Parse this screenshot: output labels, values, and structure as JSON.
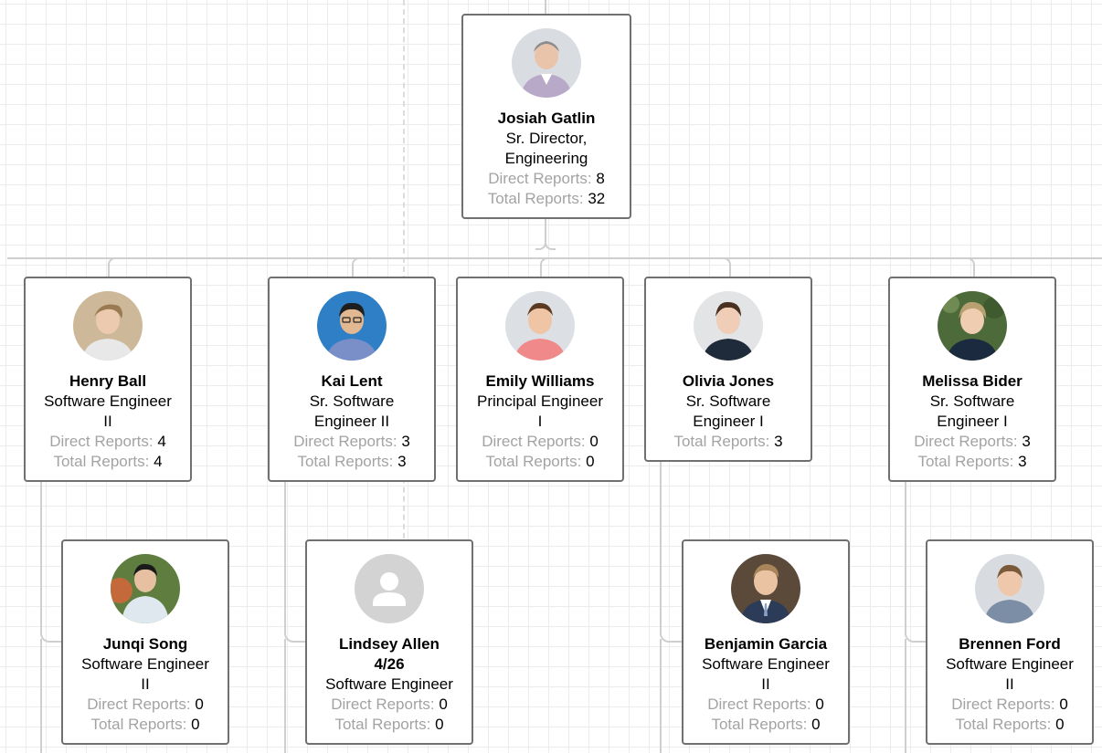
{
  "people": {
    "josiah": {
      "name": "Josiah Gatlin",
      "title_line1": "Sr. Director,",
      "title_line2": "Engineering",
      "direct_label": "Direct Reports:",
      "direct": "8",
      "total_label": "Total Reports:",
      "total": "32",
      "avatar": "photo-avatar"
    },
    "henry": {
      "name": "Henry Ball",
      "title_line1": "Software Engineer",
      "title_line2": "II",
      "direct_label": "Direct Reports:",
      "direct": "4",
      "total_label": "Total Reports:",
      "total": "4",
      "avatar": "photo-avatar"
    },
    "kai": {
      "name": "Kai Lent",
      "title_line1": "Sr. Software",
      "title_line2": "Engineer II",
      "direct_label": "Direct Reports:",
      "direct": "3",
      "total_label": "Total Reports:",
      "total": "3",
      "avatar": "photo-avatar"
    },
    "emily": {
      "name": "Emily Williams",
      "title_line1": "Principal Engineer",
      "title_line2": "I",
      "direct_label": "Direct Reports:",
      "direct": "0",
      "total_label": "Total Reports:",
      "total": "0",
      "avatar": "photo-avatar"
    },
    "olivia": {
      "name": "Olivia Jones",
      "title_line1": "Sr. Software",
      "title_line2": "Engineer I",
      "total_label": "Total Reports:",
      "total": "3",
      "avatar": "photo-avatar"
    },
    "melissa": {
      "name": "Melissa Bider",
      "title_line1": "Sr. Software",
      "title_line2": "Engineer I",
      "direct_label": "Direct Reports:",
      "direct": "3",
      "total_label": "Total Reports:",
      "total": "3",
      "avatar": "photo-avatar"
    },
    "junqi": {
      "name": "Junqi Song",
      "title_line1": "Software Engineer",
      "title_line2": "II",
      "direct_label": "Direct Reports:",
      "direct": "0",
      "total_label": "Total Reports:",
      "total": "0",
      "avatar": "photo-avatar"
    },
    "lindsey": {
      "name_line1": "Lindsey Allen",
      "name_line2": "4/26",
      "title_line1": "Software Engineer",
      "direct_label": "Direct Reports:",
      "direct": "0",
      "total_label": "Total Reports:",
      "total": "0",
      "avatar": "placeholder-person-icon"
    },
    "benjamin": {
      "name": "Benjamin Garcia",
      "title_line1": "Software Engineer",
      "title_line2": "II",
      "direct_label": "Direct Reports:",
      "direct": "0",
      "total_label": "Total Reports:",
      "total": "0",
      "avatar": "photo-avatar"
    },
    "brennen": {
      "name": "Brennen Ford",
      "title_line1": "Software Engineer",
      "title_line2": "II",
      "direct_label": "Direct Reports:",
      "direct": "0",
      "total_label": "Total Reports:",
      "total": "0",
      "avatar": "photo-avatar"
    }
  },
  "colors": {
    "card_border": "#707070",
    "connector": "#cfcfcf",
    "label_gray": "#a3a3a3",
    "grid": "#ececec"
  }
}
